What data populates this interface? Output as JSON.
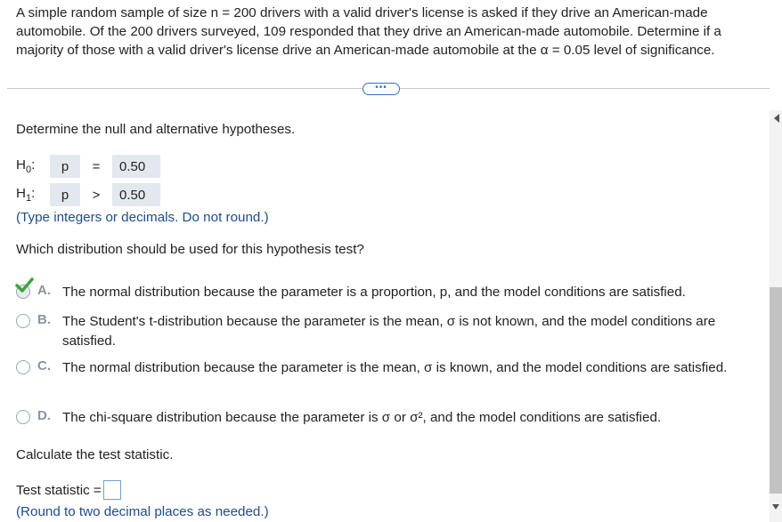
{
  "problem": {
    "text": "A simple random sample of size n = 200 drivers with a valid driver's license is asked if they drive an American-made automobile. Of the 200 drivers surveyed, 109 responded that they drive an American-made automobile. Determine if a majority of those with a valid driver's license drive an American-made automobile at the α = 0.05 level of significance."
  },
  "expand_button": {
    "label": "•••"
  },
  "hypotheses": {
    "prompt": "Determine the null and alternative hypotheses.",
    "h0": {
      "label": "H",
      "sub": "0",
      "colon": ":",
      "param": "p",
      "op": "=",
      "value": "0.50"
    },
    "h1": {
      "label": "H",
      "sub": "1",
      "colon": ":",
      "param": "p",
      "op": ">",
      "value": "0.50"
    },
    "hint": "(Type integers or decimals. Do not round.)"
  },
  "distribution": {
    "prompt": "Which distribution should be used for this hypothesis test?",
    "options": [
      {
        "letter": "A.",
        "text": "The normal distribution because the parameter is a proportion, p, and the model conditions are satisfied.",
        "selected": true
      },
      {
        "letter": "B.",
        "text": "The Student's t-distribution because the parameter is the mean, σ is not known, and the model conditions are satisfied.",
        "selected": false
      },
      {
        "letter": "C.",
        "text": "The normal distribution because the parameter is the mean, σ is known, and the model conditions are satisfied.",
        "selected": false
      },
      {
        "letter": "D.",
        "text": "The chi-square distribution because the parameter is σ or σ², and the model conditions are satisfied.",
        "selected": false
      }
    ]
  },
  "test_statistic": {
    "prompt": "Calculate the test statistic.",
    "label": "Test statistic =",
    "value": "",
    "hint": "(Round to two decimal places as needed.)"
  },
  "colors": {
    "hint_blue": "#1f4c8a",
    "check_green": "#3aa63a",
    "box_fill": "#e3e8ef"
  }
}
